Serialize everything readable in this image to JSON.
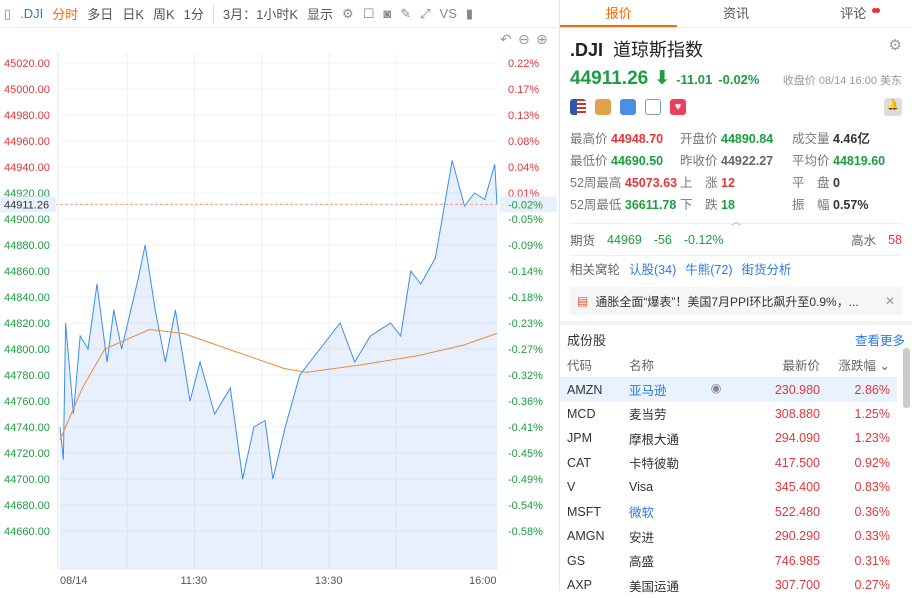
{
  "toolbar": {
    "symbol": ".DJI",
    "items": [
      "分时",
      "多日",
      "日K",
      "周K",
      "1分",
      "3月：1小时K",
      "显示",
      "VS"
    ]
  },
  "tabs": [
    "报价",
    "资讯",
    "评论"
  ],
  "quote": {
    "code": ".DJI",
    "name": "道琼斯指数",
    "last": "44911.26",
    "change": "-11.01",
    "pct": "-0.02%",
    "timestamp": "收盘价 08/14 16:00 美东",
    "stats": [
      [
        "最高价",
        "44948.70",
        "r"
      ],
      [
        "开盘价",
        "44890.84",
        "g"
      ],
      [
        "成交量",
        "4.46亿",
        "k"
      ],
      [
        "最低价",
        "44690.50",
        "g"
      ],
      [
        "昨收价",
        "44922.27",
        "gr"
      ],
      [
        "平均价",
        "44819.60",
        "g"
      ],
      [
        "52周最高",
        "45073.63",
        "r"
      ],
      [
        "上　涨",
        "12",
        "r"
      ],
      [
        "平　盘",
        "0",
        "k"
      ],
      [
        "52周最低",
        "36611.78",
        "g"
      ],
      [
        "下　跌",
        "18",
        "g"
      ],
      [
        "振　幅",
        "0.57%",
        "k"
      ]
    ]
  },
  "futures": {
    "label": "期货",
    "price": "44969",
    "change": "-56",
    "pct": "-0.12%",
    "premium_label": "高水",
    "premium": "58"
  },
  "warrants": {
    "label": "相关窝轮",
    "links": [
      "认股(34)",
      "牛熊(72)",
      "街货分析"
    ]
  },
  "news": "通胀全面“爆表”！美国7月PPI环比飙升至0.9%，...",
  "constituents": {
    "title": "成份股",
    "more": "查看更多",
    "headers": [
      "代码",
      "名称",
      "最新价",
      "涨跌幅"
    ],
    "rows": [
      [
        "AMZN",
        "亚马逊",
        "230.980",
        "2.86%"
      ],
      [
        "MCD",
        "麦当劳",
        "308.880",
        "1.25%"
      ],
      [
        "JPM",
        "摩根大通",
        "294.090",
        "1.23%"
      ],
      [
        "CAT",
        "卡特彼勒",
        "417.500",
        "0.92%"
      ],
      [
        "V",
        "Visa",
        "345.400",
        "0.83%"
      ],
      [
        "MSFT",
        "微软",
        "522.480",
        "0.36%"
      ],
      [
        "AMGN",
        "安进",
        "290.290",
        "0.33%"
      ],
      [
        "GS",
        "高盛",
        "746.985",
        "0.31%"
      ],
      [
        "AXP",
        "美国运通",
        "307.700",
        "0.27%"
      ]
    ]
  },
  "chart_data": {
    "type": "line",
    "prev_close": 44922.27,
    "current_label": "44911.26",
    "current_pct": "-0.02%",
    "yticks": [
      45020,
      45000,
      44980,
      44960,
      44940,
      44920,
      44900,
      44880,
      44860,
      44840,
      44820,
      44800,
      44780,
      44760,
      44740,
      44720,
      44700,
      44680,
      44660
    ],
    "pct_ticks": [
      "0.22%",
      "0.17%",
      "0.13%",
      "0.08%",
      "0.04%",
      "0.01%",
      "-0.05%",
      "-0.09%",
      "-0.14%",
      "-0.18%",
      "-0.23%",
      "-0.27%",
      "-0.32%",
      "-0.36%",
      "-0.41%",
      "-0.45%",
      "-0.49%",
      "-0.54%",
      "-0.58%"
    ],
    "xticks": [
      {
        "label": "08/14",
        "min": 0
      },
      {
        "label": "11:30",
        "min": 120
      },
      {
        "label": "13:30",
        "min": 240
      },
      {
        "label": "16:00",
        "min": 390
      }
    ],
    "price": [
      [
        0,
        44740
      ],
      [
        3,
        44715
      ],
      [
        5,
        44820
      ],
      [
        8,
        44790
      ],
      [
        12,
        44750
      ],
      [
        18,
        44810
      ],
      [
        25,
        44800
      ],
      [
        33,
        44850
      ],
      [
        42,
        44790
      ],
      [
        48,
        44830
      ],
      [
        55,
        44800
      ],
      [
        70,
        44855
      ],
      [
        76,
        44880
      ],
      [
        85,
        44830
      ],
      [
        94,
        44790
      ],
      [
        103,
        44830
      ],
      [
        116,
        44760
      ],
      [
        125,
        44790
      ],
      [
        138,
        44750
      ],
      [
        152,
        44770
      ],
      [
        163,
        44700
      ],
      [
        173,
        44740
      ],
      [
        183,
        44745
      ],
      [
        190,
        44700
      ],
      [
        201,
        44740
      ],
      [
        214,
        44780
      ],
      [
        232,
        44800
      ],
      [
        250,
        44820
      ],
      [
        263,
        44790
      ],
      [
        277,
        44810
      ],
      [
        295,
        44820
      ],
      [
        304,
        44810
      ],
      [
        313,
        44860
      ],
      [
        322,
        44850
      ],
      [
        335,
        44870
      ],
      [
        341,
        44900
      ],
      [
        350,
        44945
      ],
      [
        361,
        44910
      ],
      [
        370,
        44920
      ],
      [
        379,
        44915
      ],
      [
        388,
        44942
      ],
      [
        390,
        44911
      ]
    ],
    "average": [
      [
        0,
        44730
      ],
      [
        20,
        44770
      ],
      [
        40,
        44800
      ],
      [
        80,
        44815
      ],
      [
        110,
        44812
      ],
      [
        150,
        44800
      ],
      [
        200,
        44785
      ],
      [
        220,
        44782
      ],
      [
        270,
        44788
      ],
      [
        320,
        44795
      ],
      [
        360,
        44803
      ],
      [
        390,
        44812
      ]
    ]
  }
}
